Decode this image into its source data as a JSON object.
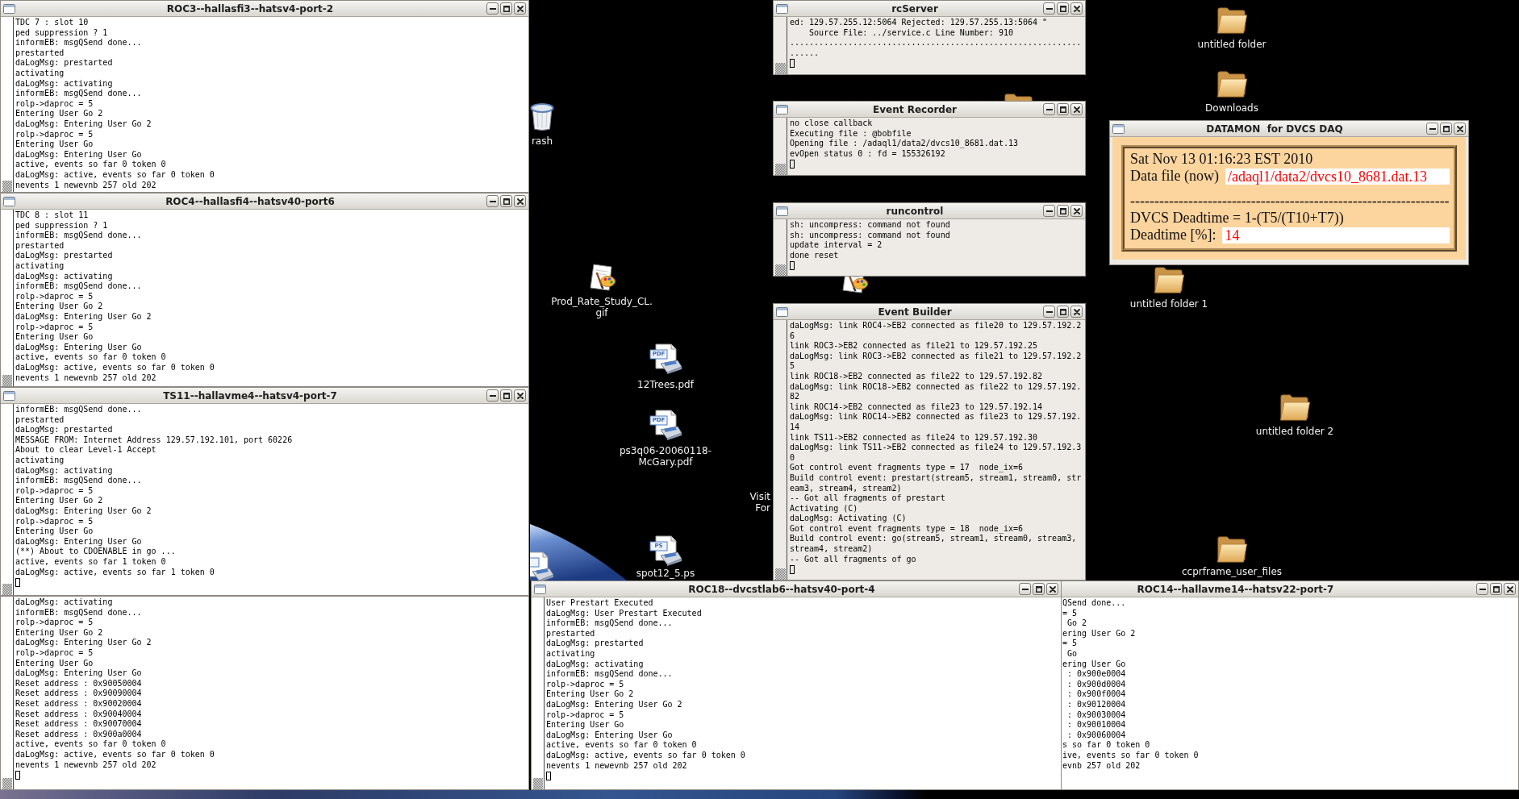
{
  "desktop": {
    "icons": [
      {
        "kind": "trash",
        "label": [
          "rash"
        ]
      },
      {
        "kind": "folder",
        "label": [
          "untitled folder"
        ]
      },
      {
        "kind": "folder",
        "label": [
          "Downloads"
        ]
      },
      {
        "kind": "folder"
      },
      {
        "kind": "image",
        "label": [
          "Prod_Rate_Study_CL.",
          "gif"
        ]
      },
      {
        "kind": "image"
      },
      {
        "kind": "folder",
        "label": [
          "untitled folder 1"
        ]
      },
      {
        "kind": "document",
        "badge": "PDF",
        "label": [
          "12Trees.pdf"
        ]
      },
      {
        "kind": "document",
        "badge": "PDF",
        "label": [
          "ps3q06-20060118-",
          "McGary.pdf"
        ]
      },
      {
        "kind": "covered",
        "label": [
          "Visit",
          "For"
        ]
      },
      {
        "kind": "folder",
        "label": [
          "untitled folder 2"
        ]
      },
      {
        "kind": "document",
        "badge": "PS",
        "label": [
          "spot12_5.ps"
        ]
      },
      {
        "kind": "document"
      },
      {
        "kind": "folder",
        "label": [
          "ccprframe_user_files"
        ]
      }
    ]
  },
  "windows": [
    {
      "kind": "xterm",
      "title": "ROC3--hallasfi3--hatsv4-port-2",
      "cut_off_left": false,
      "cursor": false,
      "lines": [
        "TDC 7 : slot 10",
        "ped suppression ? 1",
        "informEB: msgQSend done...",
        "prestarted",
        "daLogMsg: prestarted",
        "activating",
        "daLogMsg: activating",
        "informEB: msgQSend done...",
        "rolp->daproc = 5",
        "Entering User Go 2",
        "daLogMsg: Entering User Go 2",
        "rolp->daproc = 5",
        "Entering User Go",
        "daLogMsg: Entering User Go",
        "active, events so far 0 token 0",
        "daLogMsg: active, events so far 0 token 0",
        "nevents 1 newevnb 257 old 202"
      ]
    },
    {
      "kind": "xterm",
      "title": "ROC4--hallasfi4--hatsv40-port6",
      "cut_off_left": false,
      "cursor": false,
      "lines": [
        "TDC 8 : slot 11",
        "ped suppression ? 1",
        "informEB: msgQSend done...",
        "prestarted",
        "daLogMsg: prestarted",
        "activating",
        "daLogMsg: activating",
        "informEB: msgQSend done...",
        "rolp->daproc = 5",
        "Entering User Go 2",
        "daLogMsg: Entering User Go 2",
        "rolp->daproc = 5",
        "Entering User Go",
        "daLogMsg: Entering User Go",
        "active, events so far 0 token 0",
        "daLogMsg: active, events so far 0 token 0",
        "nevents 1 newevnb 257 old 202"
      ]
    },
    {
      "kind": "xterm",
      "title": "TS11--hallavme4--hatsv4-port-7",
      "cut_off_left": false,
      "cursor": true,
      "lines": [
        "informEB: msgQSend done...",
        "prestarted",
        "daLogMsg: prestarted",
        "MESSAGE FROM: Internet Address 129.57.192.101, port 60226",
        "About to clear Level-1 Accept",
        "activating",
        "daLogMsg: activating",
        "informEB: msgQSend done...",
        "rolp->daproc = 5",
        "Entering User Go 2",
        "daLogMsg: Entering User Go 2",
        "rolp->daproc = 5",
        "Entering User Go",
        "daLogMsg: Entering User Go",
        "(**) About to CDOENABLE in go ...",
        "active, events so far 1 token 0",
        "daLogMsg: active, events so far 1 token 0"
      ]
    },
    {
      "kind": "xterm",
      "cut_off_left": false,
      "cursor": true,
      "lines": [
        "daLogMsg: activating",
        "informEB: msgQSend done...",
        "rolp->daproc = 5",
        "Entering User Go 2",
        "daLogMsg: Entering User Go 2",
        "rolp->daproc = 5",
        "Entering User Go",
        "daLogMsg: Entering User Go",
        "Reset address : 0x90050004",
        "Reset address : 0x90090004",
        "Reset address : 0x90020004",
        "Reset address : 0x90040004",
        "Reset address : 0x90070004",
        "Reset address : 0x900a0004",
        "active, events so far 0 token 0",
        "daLogMsg: active, events so far 0 token 0",
        "nevents 1 newevnb 257 old 202"
      ]
    },
    {
      "kind": "console",
      "title": "rcServer",
      "cut_off_left": false,
      "cursor": true,
      "lines": [
        "ed: 129.57.255.12:5064 Rejected: 129.57.255.13:5064 \"",
        "    Source File: ../service.c Line Number: 910",
        "............................................................",
        "......"
      ]
    },
    {
      "kind": "console",
      "title": "Event Recorder",
      "cut_off_left": false,
      "cursor": true,
      "lines": [
        "no close callback",
        "Executing file : @bobfile",
        "Opening file : /adaql1/data2/dvcs10_8681.dat.13",
        "evOpen status 0 : fd = 155326192"
      ]
    },
    {
      "kind": "console",
      "title": "runcontrol",
      "cut_off_left": false,
      "cursor": true,
      "lines": [
        "sh: uncompress: command not found",
        "sh: uncompress: command not found",
        "update interval = 2",
        "done reset"
      ]
    },
    {
      "kind": "console",
      "title": "Event Builder",
      "cut_off_left": false,
      "cursor": true,
      "lines": [
        "daLogMsg: link ROC4->EB2 connected as file20 to 129.57.192.2",
        "6",
        "link ROC3->EB2 connected as file21 to 129.57.192.25",
        "daLogMsg: link ROC3->EB2 connected as file21 to 129.57.192.2",
        "5",
        "link ROC18->EB2 connected as file22 to 129.57.192.82",
        "daLogMsg: link ROC18->EB2 connected as file22 to 129.57.192.",
        "82",
        "link ROC14->EB2 connected as file23 to 129.57.192.14",
        "daLogMsg: link ROC14->EB2 connected as file23 to 129.57.192.",
        "14",
        "link TS11->EB2 connected as file24 to 129.57.192.30",
        "daLogMsg: link TS11->EB2 connected as file24 to 129.57.192.3",
        "0",
        "Got control event fragments type = 17  node_ix=6",
        "Build control event: prestart(stream5, stream1, stream0, str",
        "eam3, stream4, stream2)",
        "-- Got all fragments of prestart",
        "Activating (C)",
        "daLogMsg: Activating (C)",
        "Got control event fragments type = 18  node_ix=6",
        "Build control event: go(stream5, stream1, stream0, stream3,",
        "stream4, stream2)",
        "-- Got all fragments of go"
      ]
    },
    {
      "kind": "monitor",
      "title": "DATAMON  for DVCS DAQ",
      "rows": [
        {
          "kind": "text",
          "text": "Sat Nov 13 01:16:23 EST 2010"
        },
        {
          "kind": "field",
          "label": "Data file (now)",
          "value": "/adaql1/data2/dvcs10_8681.dat.13"
        },
        {
          "kind": "rule",
          "text": "------------------------------------------------------------------"
        },
        {
          "kind": "text",
          "text": "DVCS Deadtime = 1-(T5/(T10+T7))"
        },
        {
          "kind": "field",
          "label": "Deadtime [%]:",
          "value": "14"
        }
      ]
    },
    {
      "kind": "xterm",
      "title": "ROC18--dvcstlab6--hatsv40-port-4",
      "cut_off_left": false,
      "cursor": true,
      "lines": [
        "User Prestart Executed",
        "daLogMsg: User Prestart Executed",
        "informEB: msgQSend done...",
        "prestarted",
        "daLogMsg: prestarted",
        "activating",
        "daLogMsg: activating",
        "informEB: msgQSend done...",
        "rolp->daproc = 5",
        "Entering User Go 2",
        "daLogMsg: Entering User Go 2",
        "rolp->daproc = 5",
        "Entering User Go",
        "daLogMsg: Entering User Go",
        "active, events so far 0 token 0",
        "daLogMsg: active, events so far 0 token 0",
        "nevents 1 newevnb 257 old 202"
      ]
    },
    {
      "kind": "xterm",
      "title": "ROC14--hallavme14--hatsv22-port-7",
      "cut_off_left": true,
      "cursor": false,
      "lines": [
        "QSend done...",
        "= 5",
        " Go 2",
        "ering User Go 2",
        "= 5",
        " Go",
        "ering User Go",
        " : 0x900e0004",
        " : 0x900d0004",
        " : 0x900f0004",
        " : 0x90120004",
        " : 0x90030004",
        " : 0x90010004",
        " : 0x90060004",
        "s so far 0 token 0",
        "ive, events so far 0 token 0",
        "evnb 257 old 202"
      ]
    }
  ]
}
